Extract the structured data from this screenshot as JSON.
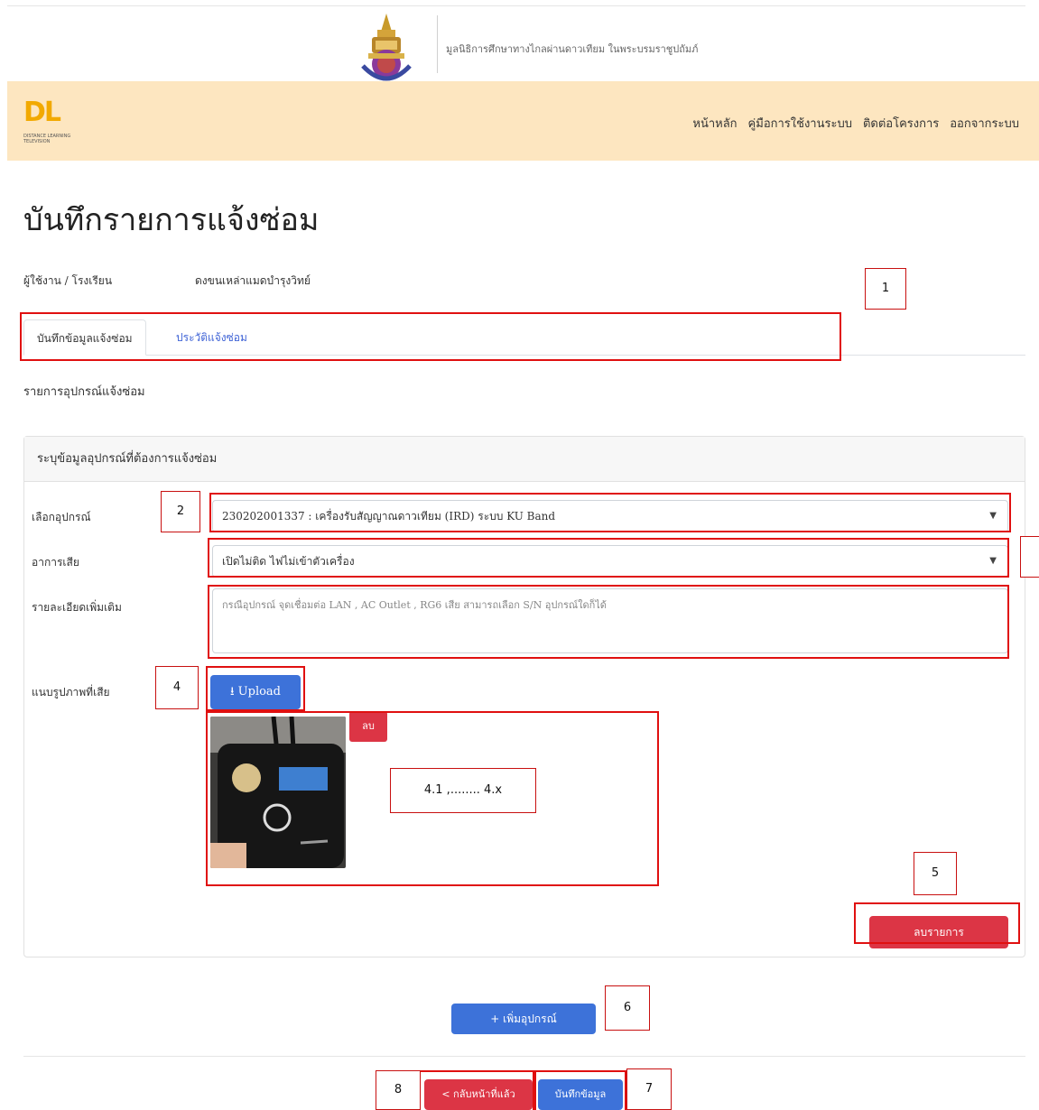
{
  "header": {
    "foundation_name": "มูลนิธิการศึกษาทางไกลผ่านดาวเทียม ในพระบรมราชูปถัมภ์"
  },
  "navbar": {
    "logo_text": "DL",
    "logo_subtext": "DISTANCE LEARNING TELEVISION",
    "links": [
      "หน้าหลัก",
      "คู่มือการใช้งานระบบ",
      "ติดต่อโครงการ",
      "ออกจากระบบ"
    ]
  },
  "page": {
    "title": "บันทึกรายการแจ้งซ่อม",
    "user_label": "ผู้ใช้งาน / โรงเรียน",
    "user_value": "ดงขนเหล่าแมดบำรุงวิทย์"
  },
  "tabs": [
    "บันทึกข้อมูลแจ้งซ่อม",
    "ประวัติแจ้งซ่อม"
  ],
  "section_label": "รายการอุปกรณ์แจ้งซ่อม",
  "card": {
    "header": "ระบุข้อมูลอุปกรณ์ที่ต้องการแจ้งซ่อม",
    "device_label": "เลือกอุปกรณ์",
    "device_value": "230202001337 : เครื่องรับสัญญาณดาวเทียม (IRD) ระบบ KU Band",
    "symptom_label": "อาการเสีย",
    "symptom_value": "เปิดไม่ติด ไฟไม่เข้าตัวเครื่อง",
    "detail_label": "รายละเอียดเพิ่มเติม",
    "detail_placeholder": "กรณีอุปกรณ์ จุดเชื่อมต่อ LAN , AC Outlet , RG6 เสีย สามารถเลือก S/N อุปกรณ์ใดก็ได้",
    "photo_label": "แนบรูปภาพที่เสีย",
    "upload_label": "Upload",
    "delete_image_label": "ลบ",
    "delete_item_label": "ลบรายการ"
  },
  "buttons": {
    "add_device": "+ เพิ่มอุปกรณ์",
    "back": "< กลับหน้าที่แล้ว",
    "save": "บันทึกข้อมูล"
  },
  "annotations": [
    "1",
    "2",
    "4",
    "4.1 ,........ 4.x",
    "5",
    "6",
    "7",
    "8"
  ],
  "colors": {
    "navbar_bg": "#fde6c0",
    "primary": "#3d72d9",
    "danger": "#dc3545",
    "annotation_red": "#e01010"
  }
}
